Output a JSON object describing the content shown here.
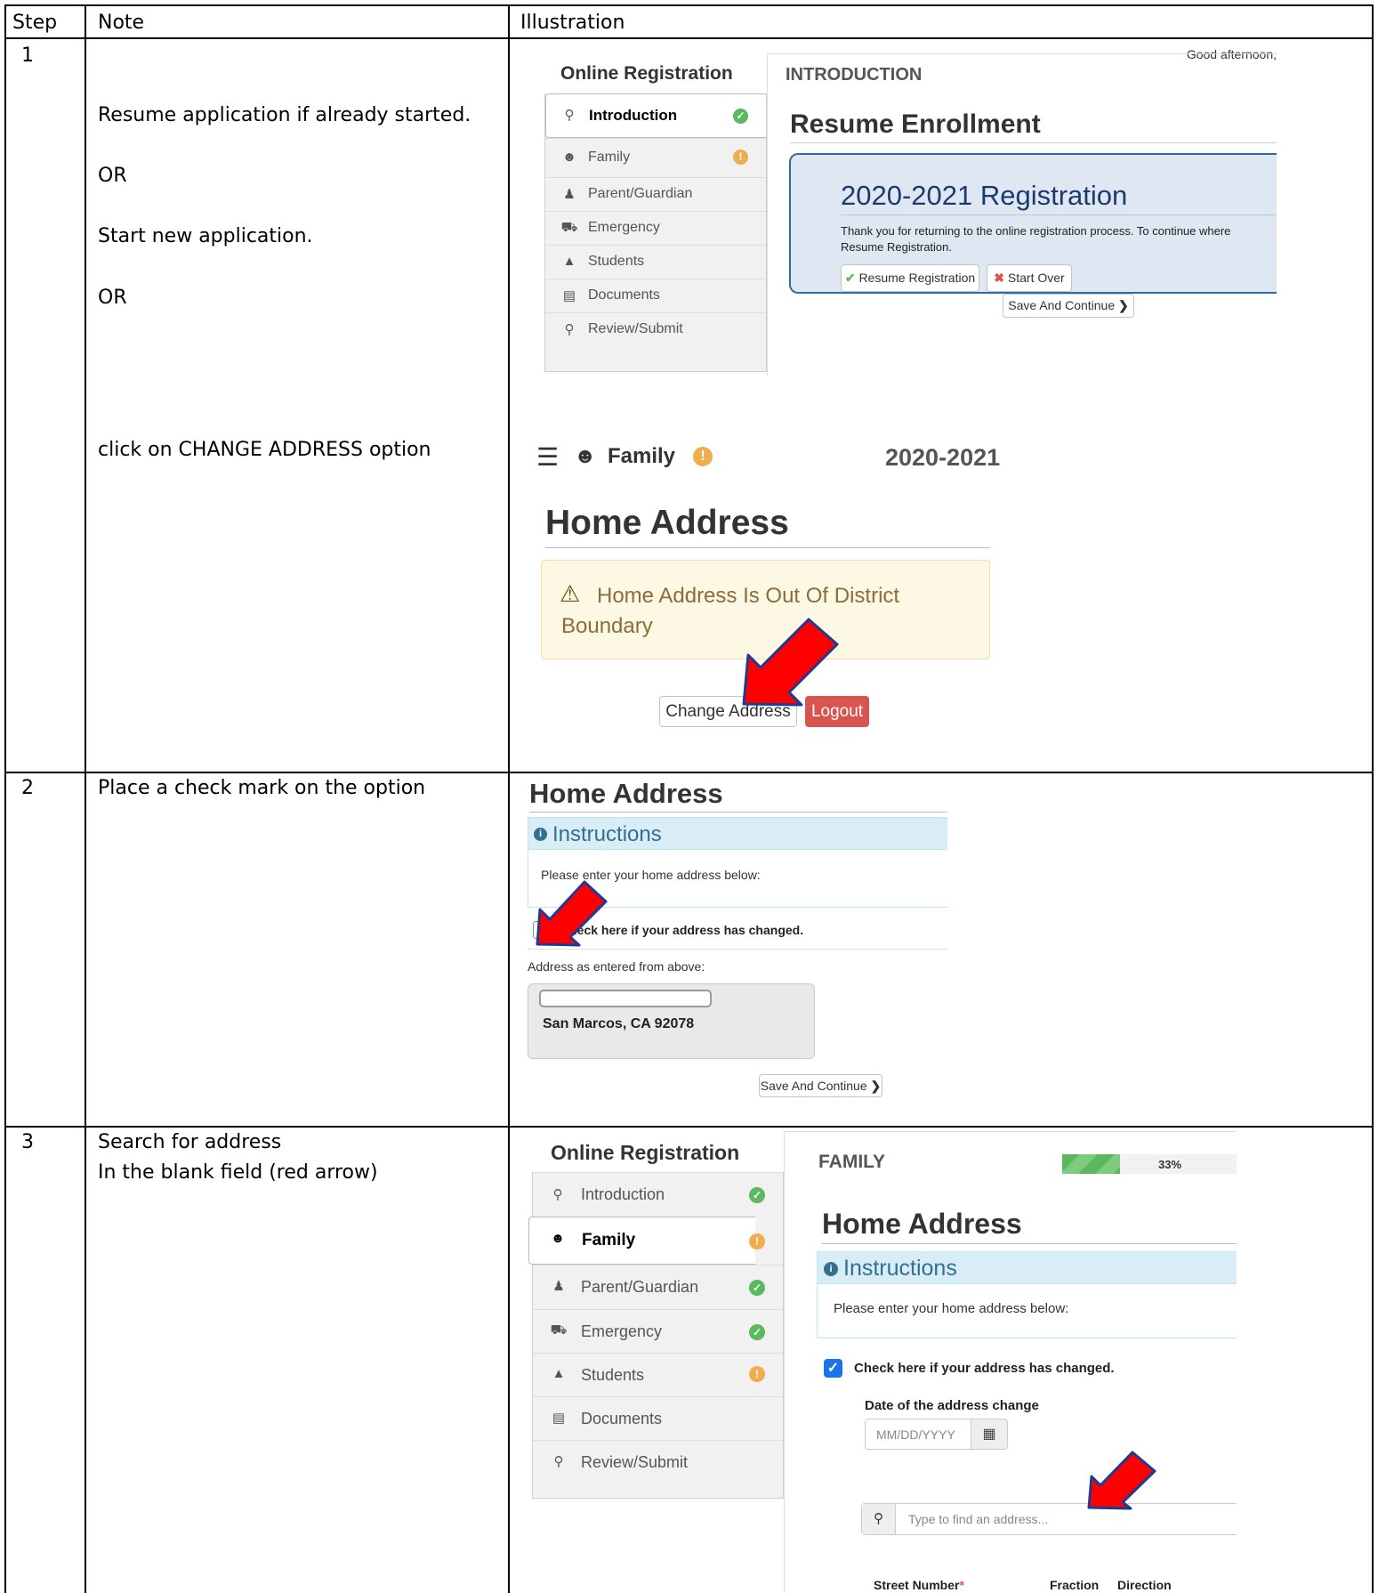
{
  "table": {
    "headers": {
      "step": "Step",
      "note": "Note",
      "illustration": "Illustration"
    },
    "rows": [
      {
        "step": "1",
        "notes": [
          "Resume application if already started.",
          "OR",
          "Start new application.",
          "OR",
          "click on CHANGE ADDRESS option"
        ]
      },
      {
        "step": "2",
        "notes": [
          "Place a check mark on the option"
        ]
      },
      {
        "step": "3",
        "notes": [
          "Search for address",
          "In the blank field (red arrow)"
        ]
      }
    ]
  },
  "shot1": {
    "greeting": "Good afternoon,",
    "sidebar_title": "Online Registration",
    "nav": [
      {
        "label": "Introduction",
        "icon": "lightbulb-icon",
        "status": "ok"
      },
      {
        "label": "Family",
        "icon": "users-icon",
        "status": "warn"
      },
      {
        "label": "Parent/Guardian",
        "icon": "user-icon",
        "status": ""
      },
      {
        "label": "Emergency",
        "icon": "ambulance-icon",
        "status": ""
      },
      {
        "label": "Students",
        "icon": "graduation-cap-icon",
        "status": ""
      },
      {
        "label": "Documents",
        "icon": "document-icon",
        "status": ""
      },
      {
        "label": "Review/Submit",
        "icon": "search-icon",
        "status": ""
      }
    ],
    "section_title": "INTRODUCTION",
    "heading": "Resume Enrollment",
    "card_title": "2020-2021 Registration",
    "card_text_1": "Thank you for returning to the online registration process. To continue where",
    "card_text_2": "Resume Registration.",
    "resume_button": "Resume Registration",
    "start_over_button": "Start Over",
    "save_continue": "Save And Continue"
  },
  "shot2": {
    "header_title": "Family",
    "school_year": "2020-2021",
    "heading": "Home Address",
    "alert_line1": "Home Address Is Out Of District",
    "alert_line2": "Boundary",
    "change_address": "Change Address",
    "logout": "Logout"
  },
  "shot3": {
    "heading": "Home Address",
    "instructions_title": "Instructions",
    "instructions_text": "Please enter your home address below:",
    "checkbox_label": "Check here if your address has changed.",
    "address_caption": "Address as entered from above:",
    "address_city": "San Marcos, CA 92078",
    "save_continue": "Save And Continue"
  },
  "shot4": {
    "sidebar_title": "Online Registration",
    "nav": [
      {
        "label": "Introduction",
        "icon": "lightbulb-icon",
        "status": "ok"
      },
      {
        "label": "Family",
        "icon": "users-icon",
        "status": "warn"
      },
      {
        "label": "Parent/Guardian",
        "icon": "user-icon",
        "status": "ok"
      },
      {
        "label": "Emergency",
        "icon": "ambulance-icon",
        "status": "ok"
      },
      {
        "label": "Students",
        "icon": "graduation-cap-icon",
        "status": "warn"
      },
      {
        "label": "Documents",
        "icon": "document-icon",
        "status": ""
      },
      {
        "label": "Review/Submit",
        "icon": "search-icon",
        "status": ""
      }
    ],
    "section_title": "FAMILY",
    "progress_label": "33%",
    "progress_value": 0.33,
    "heading": "Home Address",
    "instructions_title": "Instructions",
    "instructions_text": "Please enter your home address below:",
    "checkbox_label": "Check here if your address has changed.",
    "date_label": "Date of the address change",
    "date_placeholder": "MM/DD/YYYY",
    "search_placeholder": "Type to find an address...",
    "col_street_number": "Street Number",
    "col_fraction": "Fraction",
    "col_direction": "Direction"
  },
  "colors": {
    "ok_green": "#5cb85c",
    "warn_orange": "#f0ad4e",
    "logout_red": "#d9534f",
    "info_blue": "#31708f",
    "checkbox_blue": "#1a73e8",
    "arrow_red": "#ff0000",
    "arrow_outline": "#1f3a93"
  }
}
